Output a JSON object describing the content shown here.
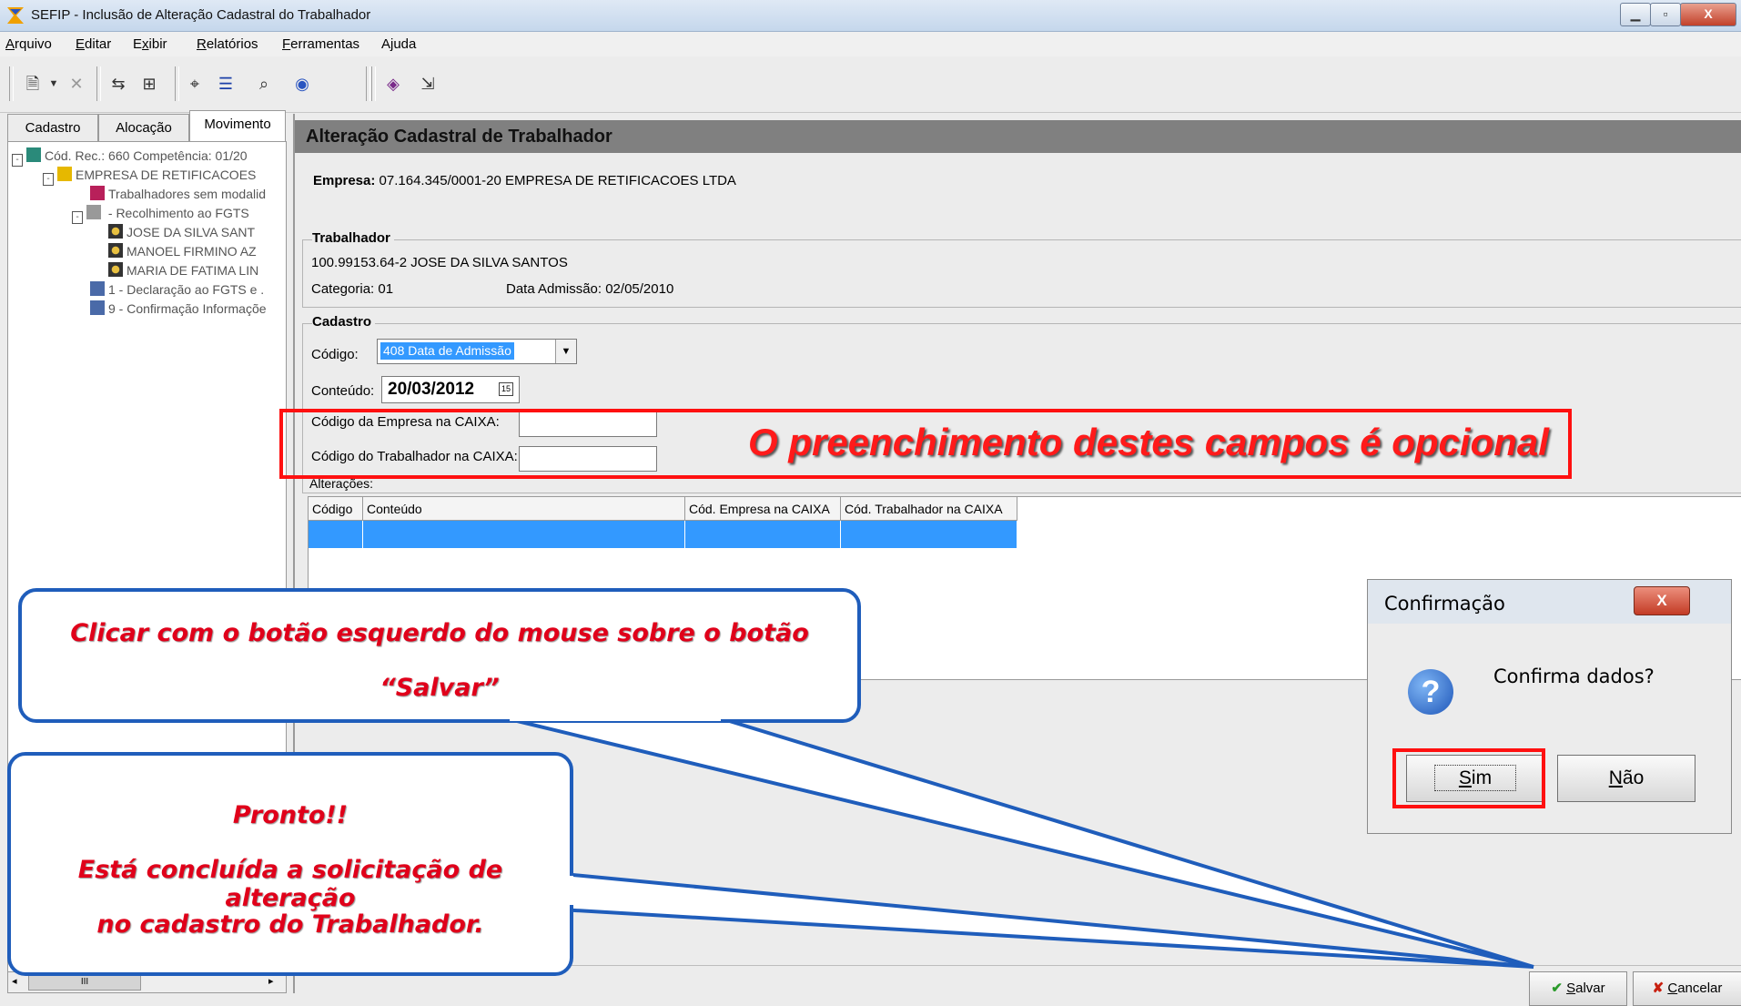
{
  "window": {
    "title": "SEFIP - Inclusão de Alteração Cadastral do Trabalhador"
  },
  "menu": [
    {
      "pre": "",
      "u": "A",
      "post": "rquivo"
    },
    {
      "pre": "",
      "u": "E",
      "post": "ditar"
    },
    {
      "pre": "E",
      "u": "x",
      "post": "ibir"
    },
    {
      "pre": "",
      "u": "R",
      "post": "elatórios"
    },
    {
      "pre": "",
      "u": "F",
      "post": "erramentas"
    },
    {
      "pre": "Ajuda",
      "u": "",
      "post": ""
    }
  ],
  "tabs": [
    "Cadastro",
    "Alocação",
    "Movimento"
  ],
  "tree": [
    "Cód. Rec.: 660 Competência: 01/20",
    "EMPRESA DE RETIFICACOES",
    "Trabalhadores sem modalid",
    " - Recolhimento ao FGTS",
    "JOSE DA SILVA SANT",
    "MANOEL FIRMINO AZ",
    "MARIA DE FATIMA LIN",
    "1 - Declaração ao FGTS e .",
    "9 - Confirmação Informaçõe"
  ],
  "panel": {
    "heading": "Alteração Cadastral de Trabalhador",
    "empresa_label": "Empresa:",
    "empresa_value": "07.164.345/0001-20  EMPRESA DE RETIFICACOES LTDA",
    "trabalhador_legend": "Trabalhador",
    "trabalhador_line": "100.99153.64-2 JOSE DA SILVA SANTOS",
    "categoria": "Categoria: 01",
    "data_admissao": "Data Admissão: 02/05/2010",
    "cadastro_legend": "Cadastro",
    "codigo_label": "Código:",
    "codigo_value": "408 Data de Admissão",
    "conteudo_label": "Conteúdo:",
    "conteudo_value": "20/03/2012",
    "calendar_glyph": "15",
    "empresa_caixa_label": "Código da Empresa na CAIXA:",
    "trabalhador_caixa_label": "Código do Trabalhador na CAIXA:",
    "alteracoes_label": "Alterações:",
    "grid_headers": [
      "Código",
      "Conteúdo",
      "Cód. Empresa na CAIXA",
      "Cód. Trabalhador na CAIXA"
    ]
  },
  "buttons": {
    "salvar_u": "S",
    "salvar_rest": "alvar",
    "cancelar_u": "C",
    "cancelar_rest": "ancelar"
  },
  "annotations": {
    "optional_note": "O preenchimento destes campos é opcional",
    "callout1_line1": "Clicar com o botão esquerdo do mouse sobre o botão",
    "callout1_line2": "“Salvar”",
    "callout2_line1": "Pronto!!",
    "callout2_line2": "Está concluída a solicitação de alteração",
    "callout2_line3": "no cadastro do Trabalhador."
  },
  "dialog": {
    "title": "Confirmação",
    "close": "X",
    "message": "Confirma dados?",
    "icon": "?",
    "sim_u": "S",
    "sim_rest": "im",
    "nao_u": "N",
    "nao_rest": "ão"
  },
  "colors": {
    "selection": "#3399ff",
    "annotation_red": "#ff1a1a",
    "callout_border": "#1f5dbb",
    "header_gray": "#808080"
  },
  "icons": [
    "sefip-app-icon",
    "minimize-icon",
    "maximize-icon",
    "close-icon",
    "question-icon",
    "check-icon",
    "x-cancel-icon",
    "calendar-icon"
  ]
}
